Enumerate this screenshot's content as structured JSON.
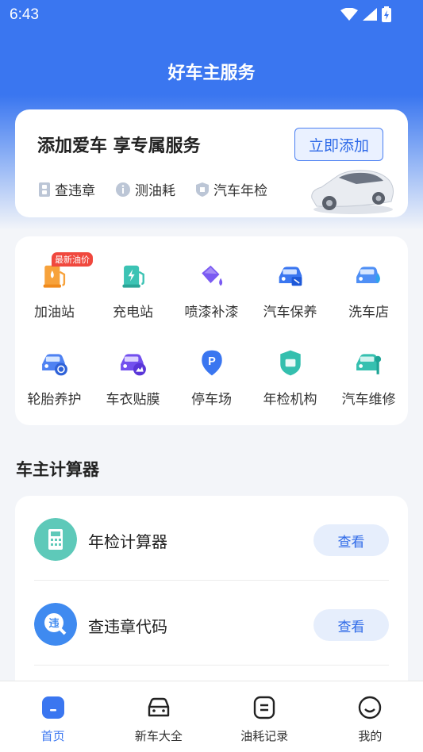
{
  "status_bar": {
    "time": "6:43"
  },
  "header": {
    "title": "好车主服务"
  },
  "car_card": {
    "headline": "添加爱车 享专属服务",
    "add_button": "立即添加",
    "features": [
      {
        "label": "查违章",
        "icon": "violation-icon"
      },
      {
        "label": "测油耗",
        "icon": "info-icon"
      },
      {
        "label": "汽车年检",
        "icon": "shield-icon"
      }
    ]
  },
  "services": {
    "badge": "最新油价",
    "items": [
      {
        "label": "加油站",
        "icon": "gas-station-icon"
      },
      {
        "label": "充电站",
        "icon": "charging-station-icon"
      },
      {
        "label": "喷漆补漆",
        "icon": "paint-bucket-icon"
      },
      {
        "label": "汽车保养",
        "icon": "car-maintenance-icon"
      },
      {
        "label": "洗车店",
        "icon": "car-wash-icon"
      },
      {
        "label": "轮胎养护",
        "icon": "tire-care-icon"
      },
      {
        "label": "车衣贴膜",
        "icon": "car-film-icon"
      },
      {
        "label": "停车场",
        "icon": "parking-icon"
      },
      {
        "label": "年检机构",
        "icon": "inspection-icon"
      },
      {
        "label": "汽车维修",
        "icon": "car-repair-icon"
      }
    ]
  },
  "calculator": {
    "section_title": "车主计算器",
    "rows": [
      {
        "label": "年检计算器",
        "button": "查看",
        "icon": "calculator-icon"
      },
      {
        "label": "查违章代码",
        "button": "查看",
        "icon": "violation-code-icon",
        "icon_text": "违"
      }
    ]
  },
  "tabbar": {
    "tabs": [
      {
        "label": "首页",
        "icon": "home-icon",
        "active": true
      },
      {
        "label": "新车大全",
        "icon": "car-icon",
        "active": false
      },
      {
        "label": "油耗记录",
        "icon": "record-icon",
        "active": false
      },
      {
        "label": "我的",
        "icon": "profile-icon",
        "active": false
      }
    ]
  },
  "colors": {
    "primary": "#3a76f0",
    "badge": "#f0483e"
  }
}
